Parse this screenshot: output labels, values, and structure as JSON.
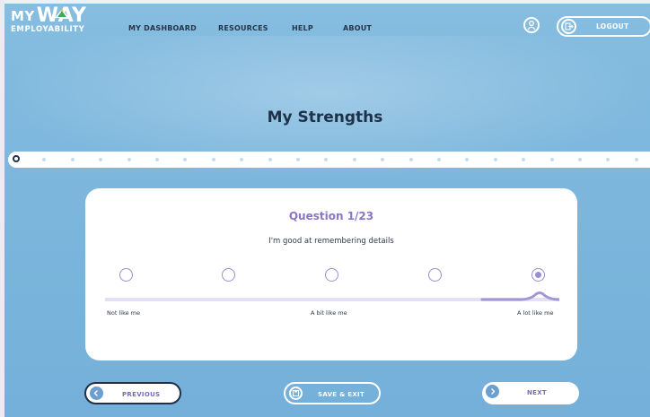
{
  "logo": {
    "line1_a": "MY",
    "line1_b": "WAY",
    "line2": "EMPLOYABILITY"
  },
  "nav": {
    "dashboard": "MY DASHBOARD",
    "resources": "RESOURCES",
    "help": "HELP",
    "about": "ABOUT"
  },
  "header": {
    "logout": "LOGOUT"
  },
  "page": {
    "title": "My Strengths"
  },
  "progress": {
    "total_steps": 23,
    "current_step": 1
  },
  "question": {
    "number_label": "Question 1/23",
    "text": "I'm good at remembering details",
    "options_count": 5,
    "selected_index": 4,
    "scale_labels": {
      "low": "Not like me",
      "mid": "A bit like me",
      "high": "A lot like me"
    }
  },
  "buttons": {
    "previous": "PREVIOUS",
    "save_exit": "SAVE & EXIT",
    "next": "NEXT"
  },
  "colors": {
    "background": "#7db7dd",
    "accent": "#8875c6",
    "dark": "#1f3148"
  }
}
